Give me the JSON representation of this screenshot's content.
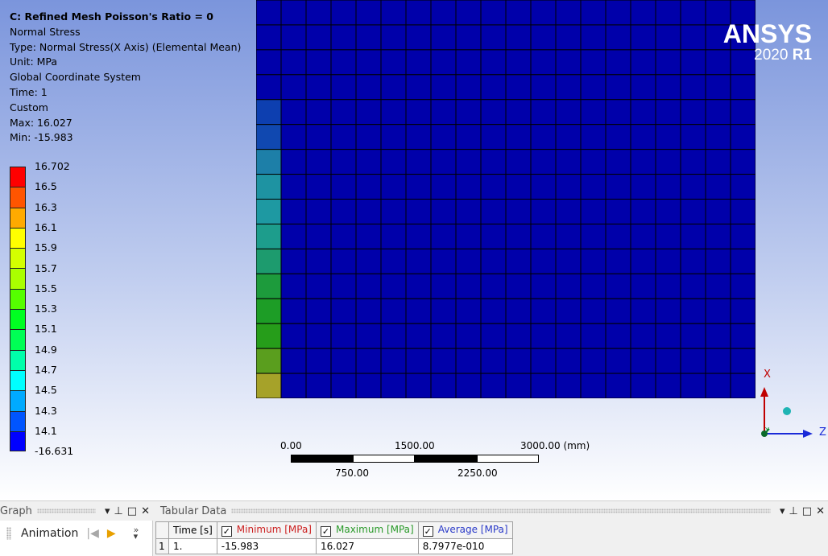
{
  "result_info": {
    "title": "C: Refined Mesh Poisson's Ratio = 0",
    "lines": [
      "Normal Stress",
      "Type: Normal Stress(X Axis) (Elemental Mean)",
      "Unit: MPa",
      "Global Coordinate System",
      "Time: 1",
      "Custom",
      "Max: 16.027",
      "Min: -15.983"
    ]
  },
  "legend": {
    "labels": [
      "16.702",
      "16.5",
      "16.3",
      "16.1",
      "15.9",
      "15.7",
      "15.5",
      "15.3",
      "15.1",
      "14.9",
      "14.7",
      "14.5",
      "14.3",
      "14.1",
      "-16.631"
    ],
    "colors": [
      "#ff0000",
      "#ff5500",
      "#ffaa00",
      "#ffff00",
      "#d4ff00",
      "#aaff00",
      "#55ff00",
      "#00ff22",
      "#00ff55",
      "#00ffaa",
      "#00ffff",
      "#00aaff",
      "#0055ff",
      "#0000ff"
    ]
  },
  "mesh": {
    "columns": 20,
    "rows": 16,
    "default_color": "#0000aa",
    "first_column_colors": [
      "#0000aa",
      "#0000aa",
      "#0000aa",
      "#0000aa",
      "#0d3fb0",
      "#1048b0",
      "#1d7fa8",
      "#1e93a2",
      "#1e99a2",
      "#1d9d8c",
      "#1d9b6e",
      "#1d9b3c",
      "#1d9d26",
      "#269d1a",
      "#5a9e1e",
      "#a6a229"
    ]
  },
  "logo": {
    "brand": "ANSYS",
    "version": "2020",
    "release": "R1"
  },
  "scale_bar": {
    "top_labels": [
      "0.00",
      "1500.00",
      "3000.00 (mm)"
    ],
    "bottom_labels": [
      "750.00",
      "2250.00"
    ]
  },
  "triad": {
    "x": "X",
    "y": "Y",
    "z": "Z"
  },
  "graph_panel": {
    "title": "Graph",
    "animation_label": "Animation",
    "icons": [
      "dropdown-icon",
      "pin-icon",
      "maximize-icon",
      "close-icon"
    ]
  },
  "tabular_panel": {
    "title": "Tabular Data",
    "headers": [
      "Time [s]",
      "Minimum [MPa]",
      "Maximum [MPa]",
      "Average [MPa]"
    ],
    "rows": [
      {
        "num": "1",
        "cells": [
          "1.",
          "-15.983",
          "16.027",
          "8.7977e-010"
        ]
      }
    ]
  }
}
